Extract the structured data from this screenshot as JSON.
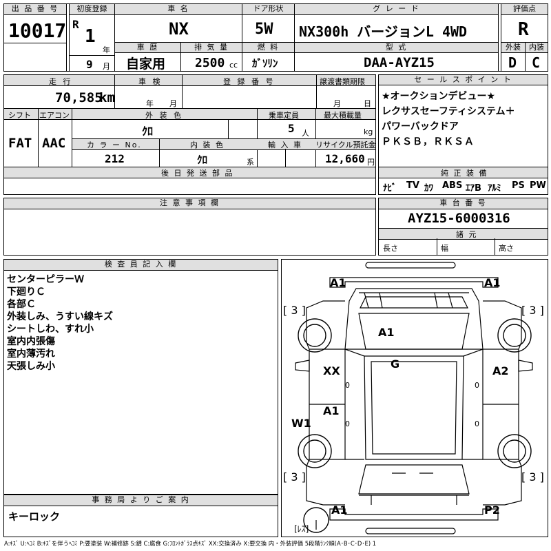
{
  "header": {
    "lot_label": "出 品 番 号",
    "lot_no": "10017",
    "reg_label": "初度登録",
    "era": "R",
    "reg_year": "1",
    "year_unit": "年",
    "reg_month": "9",
    "month_unit": "月",
    "name_label": "車 名",
    "car_name": "NX",
    "door_label": "ドア形状",
    "door": "5W",
    "grade_label": "グ レ ー ド",
    "grade": "NX300h バージョンL 4WD",
    "score_label": "評価点",
    "score": "R",
    "history_label": "車 歴",
    "history": "自家用",
    "disp_label": "排 気 量",
    "disp": "2500",
    "disp_unit": "cc",
    "fuel_label": "燃 料",
    "fuel": "ｶﾞｿﾘﾝ",
    "model_label": "型 式",
    "model": "DAA-AYZ15",
    "ext_label": "外装",
    "ext": "D",
    "int_label": "内装",
    "int": "C"
  },
  "row2": {
    "mileage_label": "走 行",
    "mileage": "70,585",
    "mileage_unit": "km",
    "inspect_label": "車 検",
    "year_unit": "年",
    "month_unit": "月",
    "regno_label": "登 録 番 号",
    "transfer_label": "譲渡書類期限",
    "transfer_month": "月",
    "transfer_day": "日",
    "shift_label": "シフト",
    "shift": "FAT",
    "ac_label": "エアコン",
    "ac": "AAC",
    "color_label": "外 装 色",
    "color": "ｸﾛ",
    "capacity_label": "乗車定員",
    "capacity": "5",
    "capacity_unit": "人",
    "load_label": "最大積載量",
    "load_unit": "kg",
    "colorno_label": "カ ラ ー No.",
    "colorno": "212",
    "intcolor_label": "内 装 色",
    "intcolor": "ｸﾛ",
    "intcolor_unit": "系",
    "import_label": "輸 入 車",
    "recycle_label": "リサイクル預託金",
    "recycle": "12,660",
    "recycle_unit": "円",
    "later_label": "後 日 発 送 部 品"
  },
  "selling": {
    "label": "セ ー ル ス ポ イ ン ト",
    "lines": [
      "★オークションデビュー★",
      "レクサスセーフティシステム＋",
      "パワーバックドア",
      "ＰＫＳＢ，ＲＫＳＡ"
    ]
  },
  "equipment": {
    "label": "純 正 装 備",
    "items": [
      "ﾅﾋﾞ",
      "TV",
      "ｶﾜ",
      "ABS",
      "ｴｱB",
      "ｱﾙﾐ",
      "PS",
      "PW"
    ]
  },
  "notes": {
    "label": "注 意 事 項 欄"
  },
  "chassis": {
    "label": "車 台 番 号",
    "value": "AYZ15-6000316",
    "dim_label": "諸 元",
    "len": "長さ",
    "wid": "幅",
    "hgt": "高さ"
  },
  "inspector": {
    "label": "検 査 員 記 入 欄",
    "lines": [
      "センターピラーＷ",
      "下廻りＣ",
      "各部Ｃ",
      "外装しみ、うすい線キズ",
      "シートしわ、すれ小",
      "室内内張傷",
      "室内薄汚れ",
      "天張しみ小"
    ]
  },
  "office": {
    "label": "事 務 局 よ り ご 案 内",
    "text": "キーロック"
  },
  "diagram": {
    "marks": [
      "A1",
      "A1",
      "A1",
      "G",
      "XX",
      "A2",
      "A1",
      "W1",
      "A1",
      "P2"
    ],
    "tires": [
      "[ 3 ]",
      "[ 3 ]",
      "[ 3 ]",
      "[ 3 ]"
    ],
    "zeros": [
      "0",
      "0",
      "0",
      "0"
    ],
    "spare": "[ﾚｽ]"
  },
  "legend": "A:ｷｽﾞ U:ﾍｺﾐ B:ｷｽﾞを伴うﾍｺﾐ P:要塗装 W:補修跡 S:錆 C:腐食 G:ﾌﾛﾝﾄｶﾞﾗｽ点ｷｽﾞ XX:交換済み X:要交換  内・外装評価 5段階ﾗﾝｸ順(A･B･C･D･E) 1"
}
